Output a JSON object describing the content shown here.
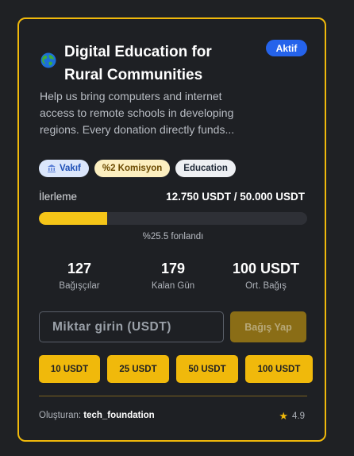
{
  "campaign": {
    "title": "Digital Education for Rural Communities",
    "status": "Aktif",
    "description": "Help us bring computers and internet\naccess to remote schools in developing\nregions. Every donation directly funds...",
    "tags": [
      {
        "icon": "building-icon",
        "label": "Vakıf"
      },
      {
        "label": "%2 Komisyon"
      },
      {
        "label": "Education"
      }
    ]
  },
  "progress": {
    "label": "İlerleme",
    "amount": "12.750 USDT / 50.000 USDT",
    "fraction": 0.255,
    "caption": "%25.5 fonlandı"
  },
  "stats": [
    {
      "value": "127",
      "label": "Bağışçılar"
    },
    {
      "value": "179",
      "label": "Kalan Gün"
    },
    {
      "value": "100 USDT",
      "label": "Ort. Bağış"
    }
  ],
  "donate": {
    "placeholder": "Miktar girin (USDT)",
    "button": "Bağış Yap",
    "quick_amounts": [
      "10 USDT",
      "25 USDT",
      "50 USDT",
      "100 USDT"
    ]
  },
  "footer": {
    "creator_label": "Oluşturan:",
    "creator_name": "tech_foundation",
    "rating": "4.9"
  },
  "colors": {
    "accent": "#f0b90b",
    "status": "#2563eb",
    "background": "#1e2024"
  }
}
